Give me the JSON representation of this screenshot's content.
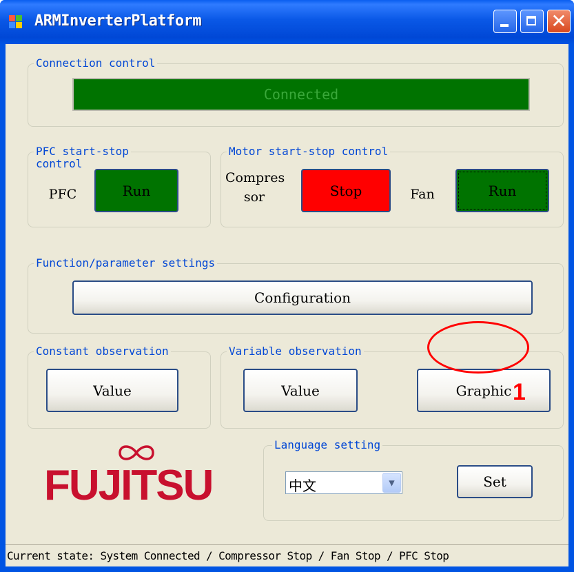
{
  "window": {
    "title": "ARMInverterPlatform",
    "minimize_label": "",
    "close_glyph": "✕"
  },
  "connection": {
    "legend": "Connection control",
    "status": "Connected"
  },
  "pfc": {
    "legend_line1": "PFC start-stop",
    "legend_line2": "control",
    "label": "PFC",
    "button": "Run"
  },
  "motor": {
    "legend": "Motor start-stop control",
    "compressor_line1": "Compres",
    "compressor_line2": "sor",
    "compressor_button": "Stop",
    "fan_label": "Fan",
    "fan_button": "Run"
  },
  "function": {
    "legend": "Function/parameter settings",
    "button": "Configuration"
  },
  "constant_obs": {
    "legend": "Constant observation",
    "value_button": "Value"
  },
  "variable_obs": {
    "legend": "Variable observation",
    "value_button": "Value",
    "graphic_button": "Graphic"
  },
  "annotation": {
    "number": "1"
  },
  "language": {
    "legend": "Language setting",
    "selected": "中文",
    "set_button": "Set"
  },
  "logo": {
    "text": "FUJITSU"
  },
  "status": {
    "text": "Current state: System Connected / Compressor Stop / Fan Stop / PFC Stop"
  },
  "colors": {
    "run_green": "#007300",
    "stop_red": "#ff0000",
    "legend_blue": "#0046d5",
    "annotation_red": "#ff0000",
    "brand_red": "#c8102e"
  }
}
